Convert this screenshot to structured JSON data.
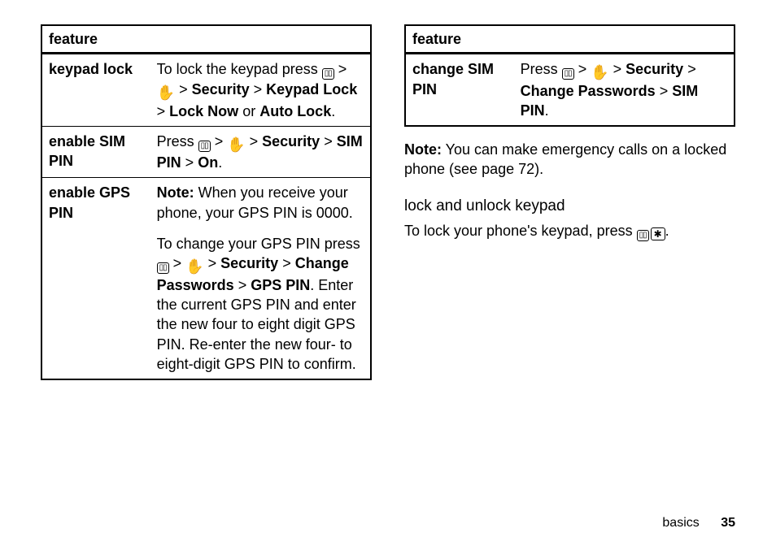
{
  "left": {
    "header": "feature",
    "rows": [
      {
        "name": "keypad lock",
        "body": {
          "t1": "To lock the keypad press ",
          "sep1": " > ",
          "sec": "Security",
          "sep2": " > ",
          "kpl": "Keypad Lock",
          "sep3": " > ",
          "ln": "Lock Now",
          "or": " or ",
          "al": "Auto Lock",
          "dot": "."
        }
      },
      {
        "name": "enable SIM PIN",
        "body": {
          "t1": "Press ",
          "sep1": " > ",
          "sec": "Security",
          "sep2": " > ",
          "sp": "SIM PIN",
          "sep3": " > ",
          "on": "On",
          "dot": "."
        }
      },
      {
        "name": "enable GPS PIN",
        "body": {
          "noteLabel": "Note:",
          "noteText": " When you receive your phone, your GPS PIN is 0000.",
          "p2a": "To change your GPS PIN press ",
          "sep1": " > ",
          "sec": "Security",
          "sep2": " > ",
          "cp": "Change Passwords",
          "sep3": " > ",
          "gp": "GPS PIN",
          "p2b": ". Enter the current GPS PIN and enter the new four to eight digit GPS PIN. Re-enter the new four- to eight-digit GPS PIN to confirm."
        }
      }
    ]
  },
  "right": {
    "header": "feature",
    "rows": [
      {
        "name": "change SIM PIN",
        "body": {
          "t1": "Press ",
          "sep1": " > ",
          "sec": "Security",
          "sep2": " > ",
          "cp": "Change Passwords",
          "sep3": " > ",
          "sp": "SIM PIN",
          "dot": "."
        }
      }
    ],
    "note": {
      "label": "Note:",
      "text": " You can make emergency calls on a locked phone (see page 72)."
    },
    "subhead": "lock and unlock keypad",
    "lockPara": {
      "a": "To lock your phone's keypad, press ",
      "b": "."
    }
  },
  "footer": {
    "section": "basics",
    "page": "35"
  },
  "icons": {
    "menu": "▯▯",
    "hand": "✋",
    "star": "✱"
  }
}
